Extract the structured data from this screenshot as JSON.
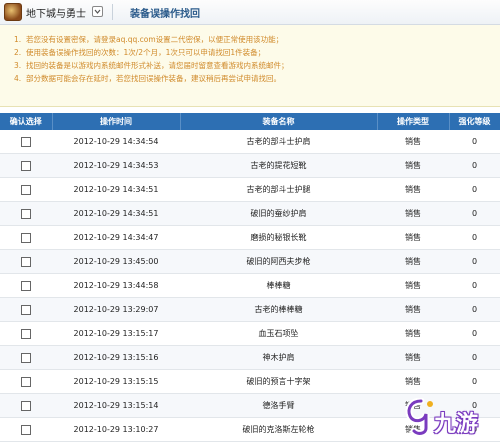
{
  "header": {
    "game_name": "地下城与勇士",
    "page_title": "装备误操作找回"
  },
  "notes": [
    {
      "num": "1.",
      "text": "若您没有设置密保，请登录aq.qq.com设置二代密保，以便正常使用该功能；"
    },
    {
      "num": "2.",
      "text": "使用装备误操作找回的次数：1次/2个月，1次只可以申请找回1件装备；"
    },
    {
      "num": "3.",
      "text": "找回的装备是以游戏内系统邮件形式补送，请您届时留意查看游戏内系统邮件；"
    },
    {
      "num": "4.",
      "text": "部分数据可能会存在延时，若您找回误操作装备，建议稍后再尝试申请找回。"
    }
  ],
  "table": {
    "headers": [
      "确认选择",
      "操作时间",
      "装备名称",
      "操作类型",
      "强化等级"
    ],
    "rows": [
      {
        "time": "2012-10-29 14:34:54",
        "name": "古老的部斗士护肩",
        "type": "销售",
        "level": "0"
      },
      {
        "time": "2012-10-29 14:34:53",
        "name": "古老的提花短靴",
        "type": "销售",
        "level": "0"
      },
      {
        "time": "2012-10-29 14:34:51",
        "name": "古老的部斗士护腿",
        "type": "销售",
        "level": "0"
      },
      {
        "time": "2012-10-29 14:34:51",
        "name": "破旧的蚕纱护肩",
        "type": "销售",
        "level": "0"
      },
      {
        "time": "2012-10-29 14:34:47",
        "name": "磨损的秘银长靴",
        "type": "销售",
        "level": "0"
      },
      {
        "time": "2012-10-29 13:45:00",
        "name": "破旧的阿西夫步枪",
        "type": "销售",
        "level": "0"
      },
      {
        "time": "2012-10-29 13:44:58",
        "name": "棒棒糖",
        "type": "销售",
        "level": "0"
      },
      {
        "time": "2012-10-29 13:29:07",
        "name": "古老的棒棒糖",
        "type": "销售",
        "level": "0"
      },
      {
        "time": "2012-10-29 13:15:17",
        "name": "血玉石项坠",
        "type": "销售",
        "level": "0"
      },
      {
        "time": "2012-10-29 13:15:16",
        "name": "神木护肩",
        "type": "销售",
        "level": "0"
      },
      {
        "time": "2012-10-29 13:15:15",
        "name": "破旧的预言十字架",
        "type": "销售",
        "level": "0"
      },
      {
        "time": "2012-10-29 13:15:14",
        "name": "德洛手臂",
        "type": "销售",
        "level": "0"
      },
      {
        "time": "2012-10-29 13:10:27",
        "name": "破旧的克洛斯左轮枪",
        "type": "销售",
        "level": "0"
      }
    ]
  },
  "watermark": {
    "text": "九游"
  },
  "colors": {
    "header_blue": "#2d6fb3",
    "note_orange": "#d08a2a",
    "title_blue": "#2a5a8a"
  }
}
